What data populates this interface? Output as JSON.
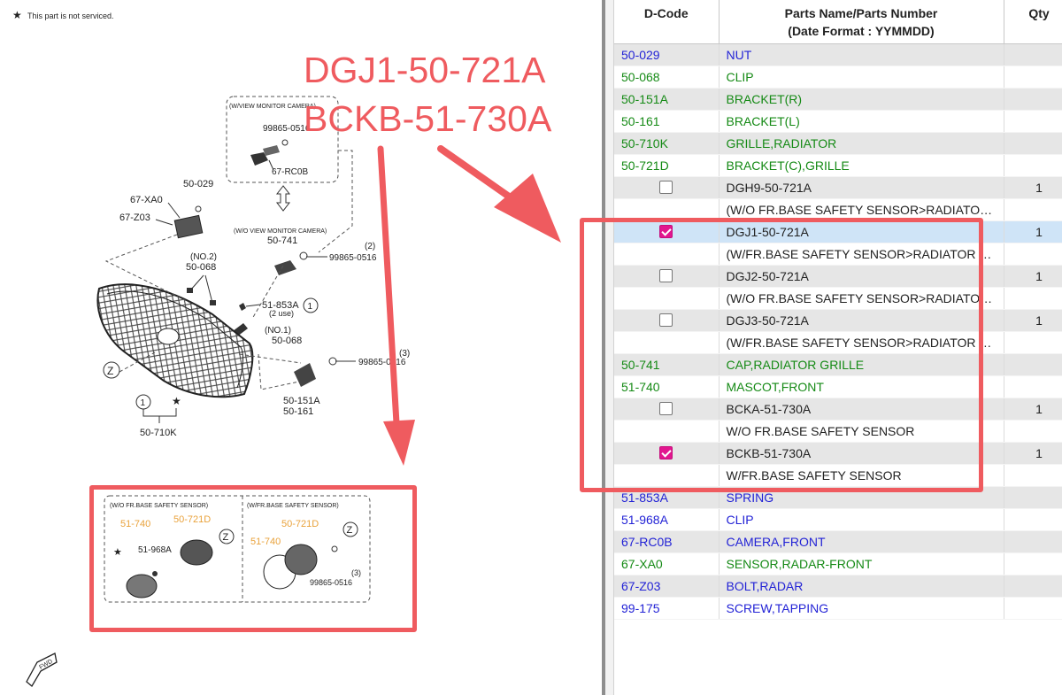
{
  "legend_note": "This part is not serviced.",
  "annotations": {
    "line1": "DGJ1-50-721A",
    "line2": "BCKB-51-730A"
  },
  "diagram": {
    "view_monitor_camera": "(W/VIEW MONITOR CAMERA)",
    "wo_view_monitor_camera": "(W/O VIEW MONITOR CAMERA)",
    "wo_fr_base_safety_sensor": "(W/O FR.BASE SAFETY SENSOR)",
    "w_fr_base_safety_sensor": "(W/FR.BASE SAFETY SENSOR)",
    "labels": {
      "c99865_0516_top": "99865-0516",
      "c67_rc0b": "67-RC0B",
      "c50_029": "50-029",
      "c67_xa0": "67-XA0",
      "c67_z03": "67-Z03",
      "c50_741": "50-741",
      "q2": "(2)",
      "c99865_0516_mid": "99865-0516",
      "no2": "(NO.2)",
      "c50_068_a": "50-068",
      "c51_853a": "51-853A",
      "two_use": "(2 use)",
      "circ1": "1",
      "no1": "(NO.1)",
      "c50_068_b": "50-068",
      "q3": "(3)",
      "c99865_0516_low": "99865-0516",
      "z_main": "Z",
      "c50_151a": "50-151A",
      "c50_161": "50-161",
      "circ1_b": "1",
      "c50_710k": "50-710K",
      "c51_740_a": "51-740",
      "c50_721d_a": "50-721D",
      "c51_968a": "51-968A",
      "z_a": "Z",
      "c50_721d_b": "50-721D",
      "z_b": "Z",
      "c51_740_b": "51-740",
      "q3_b": "(3)",
      "c99865_0516_b": "99865-0516",
      "fwd": "FWD"
    }
  },
  "table": {
    "headers": {
      "dcode": "D-Code",
      "name_line1": "Parts Name/Parts Number",
      "name_line2": "(Date Format : YYMMDD)",
      "qty": "Qty"
    },
    "rows": [
      {
        "type": "part",
        "code": "50-029",
        "name": "NUT",
        "color": "blue",
        "bg": "g",
        "qty": ""
      },
      {
        "type": "part",
        "code": "50-068",
        "name": "CLIP",
        "color": "green",
        "bg": "w",
        "qty": ""
      },
      {
        "type": "part",
        "code": "50-151A",
        "name": "BRACKET(R)",
        "color": "green",
        "bg": "g",
        "qty": ""
      },
      {
        "type": "part",
        "code": "50-161",
        "name": "BRACKET(L)",
        "color": "green",
        "bg": "w",
        "qty": ""
      },
      {
        "type": "part",
        "code": "50-710K",
        "name": "GRILLE,RADIATOR",
        "color": "green",
        "bg": "g",
        "qty": ""
      },
      {
        "type": "part",
        "code": "50-721D",
        "name": "BRACKET(C),GRILLE",
        "color": "green",
        "bg": "w",
        "qty": ""
      },
      {
        "type": "option",
        "checked": false,
        "name": "DGH9-50-721A",
        "bg": "g",
        "qty": "1"
      },
      {
        "type": "note",
        "name": "(W/O FR.BASE SAFETY SENSOR>RADIATOR GRILLE)",
        "bg": "w"
      },
      {
        "type": "option",
        "checked": true,
        "name": "DGJ1-50-721A",
        "bg": "sel",
        "qty": "1"
      },
      {
        "type": "note",
        "name": "(W/FR.BASE SAFETY SENSOR>RADIATOR GRILLE)",
        "bg": "w"
      },
      {
        "type": "option",
        "checked": false,
        "name": "DGJ2-50-721A",
        "bg": "g",
        "qty": "1"
      },
      {
        "type": "note",
        "name": "(W/O FR.BASE SAFETY SENSOR>RADIATOR GRILLE)",
        "bg": "w"
      },
      {
        "type": "option",
        "checked": false,
        "name": "DGJ3-50-721A",
        "bg": "g",
        "qty": "1"
      },
      {
        "type": "note",
        "name": "(W/FR.BASE SAFETY SENSOR>RADIATOR GRILLE)",
        "bg": "w"
      },
      {
        "type": "part",
        "code": "50-741",
        "name": "CAP,RADIATOR GRILLE",
        "color": "green",
        "bg": "g",
        "qty": ""
      },
      {
        "type": "part",
        "code": "51-740",
        "name": "MASCOT,FRONT",
        "color": "green",
        "bg": "w",
        "qty": ""
      },
      {
        "type": "option",
        "checked": false,
        "name": "BCKA-51-730A",
        "bg": "g",
        "qty": "1"
      },
      {
        "type": "note",
        "name": "W/O FR.BASE SAFETY SENSOR",
        "bg": "w"
      },
      {
        "type": "option",
        "checked": true,
        "name": "BCKB-51-730A",
        "bg": "g",
        "qty": "1"
      },
      {
        "type": "note",
        "name": "W/FR.BASE SAFETY SENSOR",
        "bg": "w"
      },
      {
        "type": "part",
        "code": "51-853A",
        "name": "SPRING",
        "color": "blue",
        "bg": "g",
        "qty": ""
      },
      {
        "type": "part",
        "code": "51-968A",
        "name": "CLIP",
        "color": "blue",
        "bg": "w",
        "qty": ""
      },
      {
        "type": "part",
        "code": "67-RC0B",
        "name": "CAMERA,FRONT",
        "color": "blue",
        "bg": "g",
        "qty": ""
      },
      {
        "type": "part",
        "code": "67-XA0",
        "name": "SENSOR,RADAR-FRONT",
        "color": "green",
        "bg": "w",
        "qty": ""
      },
      {
        "type": "part",
        "code": "67-Z03",
        "name": "BOLT,RADAR",
        "color": "blue",
        "bg": "g",
        "qty": ""
      },
      {
        "type": "part",
        "code": "99-175",
        "name": "SCREW,TAPPING",
        "color": "blue",
        "bg": "w",
        "qty": ""
      }
    ]
  },
  "colors": {
    "highlight_red": "#ef5b5f",
    "check_magenta": "#e2168f",
    "link_blue": "#2323d6",
    "link_green": "#158a15",
    "selected_row": "#cfe4f7"
  }
}
